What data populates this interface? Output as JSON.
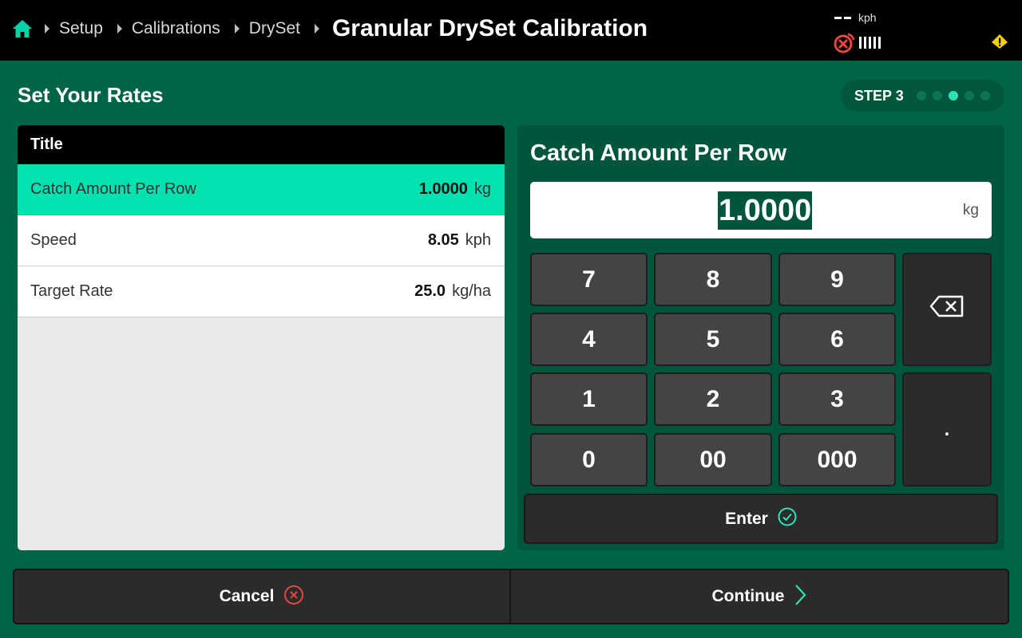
{
  "header": {
    "home_icon": "home-icon",
    "breadcrumbs": [
      "Setup",
      "Calibrations",
      "DrySet"
    ],
    "title": "Granular DrySet Calibration",
    "speed_unit": "kph",
    "status_icons": [
      "gps-signal-lost-icon",
      "signal-bars-icon",
      "warning-icon"
    ]
  },
  "section": {
    "title": "Set Your Rates",
    "step_label": "STEP 3",
    "step_total": 5,
    "step_current": 3
  },
  "table": {
    "header": "Title",
    "rows": [
      {
        "label": "Catch Amount Per Row",
        "value": "1.0000",
        "unit": "kg"
      },
      {
        "label": "Speed",
        "value": "8.05",
        "unit": "kph"
      },
      {
        "label": "Target Rate",
        "value": "25.0",
        "unit": "kg/ha"
      }
    ]
  },
  "keypad": {
    "title": "Catch Amount Per Row",
    "value": "1.0000",
    "unit": "kg",
    "keys": {
      "k7": "7",
      "k8": "8",
      "k9": "9",
      "k4": "4",
      "k5": "5",
      "k6": "6",
      "k1": "1",
      "k2": "2",
      "k3": "3",
      "k0": "0",
      "k00": "00",
      "k000": "000",
      "dot": "."
    },
    "backspace_icon": "backspace-icon",
    "enter_label": "Enter"
  },
  "footer": {
    "cancel_label": "Cancel",
    "continue_label": "Continue"
  },
  "colors": {
    "background": "#006547",
    "accent": "#00e3b0",
    "panel": "#00563c",
    "cancel_icon": "#e8473b",
    "warning": "#f5d000"
  }
}
